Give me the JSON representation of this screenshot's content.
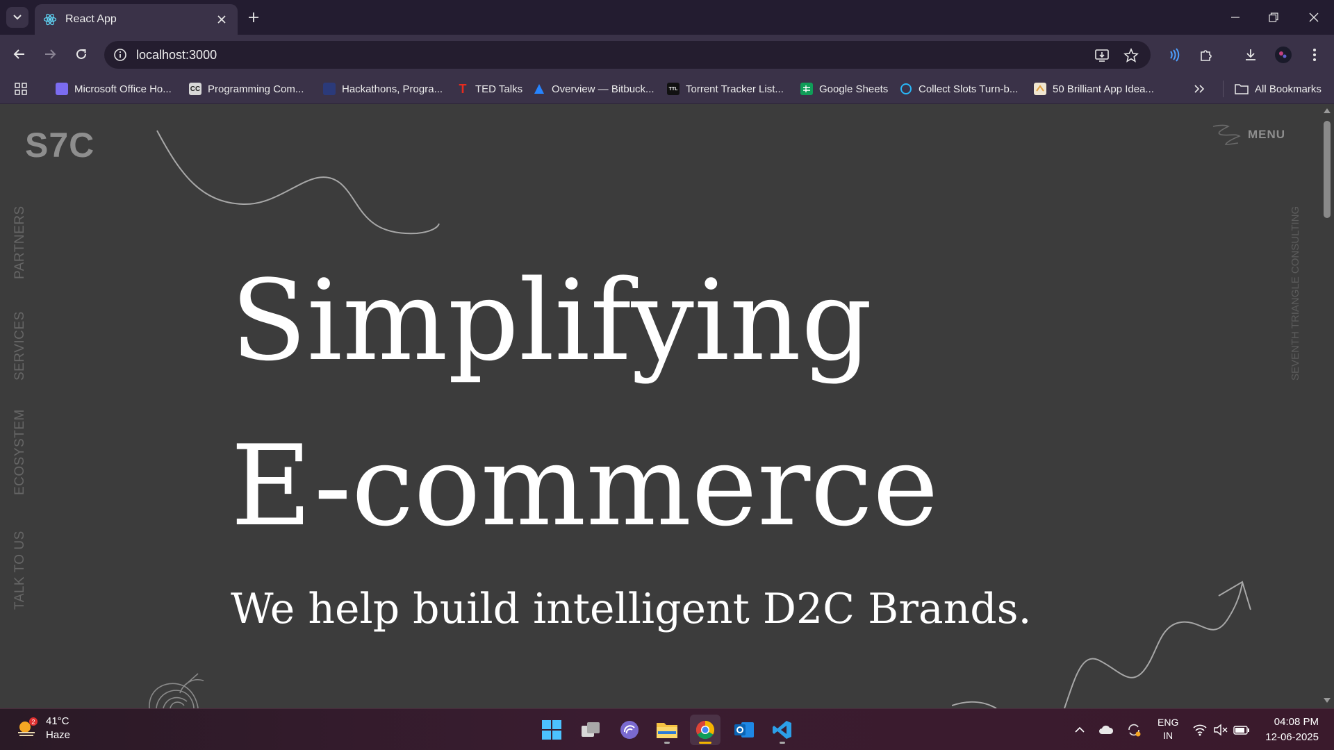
{
  "browser": {
    "tab_title": "React App",
    "url": "localhost:3000",
    "bookmarks": [
      {
        "label": "Microsoft Office Ho...",
        "icon": "office-icon",
        "color": "#7b6cf0"
      },
      {
        "label": "Programming Com...",
        "icon": "cc-icon",
        "color": "#d8d8d8"
      },
      {
        "label": "Hackathons, Progra...",
        "icon": "hackathon-icon",
        "color": "#2b3a7a"
      },
      {
        "label": "TED Talks",
        "icon": "ted-icon",
        "color": "#e62b1e"
      },
      {
        "label": "Overview — Bitbuck...",
        "icon": "bitbucket-icon",
        "color": "#2684ff"
      },
      {
        "label": "Torrent Tracker List...",
        "icon": "torrent-icon",
        "color": "#111111"
      },
      {
        "label": "Google Sheets",
        "icon": "sheets-icon",
        "color": "#0f9d58"
      },
      {
        "label": "Collect Slots Turn-b...",
        "icon": "slots-icon",
        "color": "#29b6f6"
      },
      {
        "label": "50 Brilliant App Idea...",
        "icon": "idea-icon",
        "color": "#e0a040"
      }
    ],
    "all_bookmarks_label": "All Bookmarks"
  },
  "page": {
    "logo": "S7C",
    "menu_label": "MENU",
    "side_nav": [
      "PARTNERS",
      "SERVICES",
      "ECOSYSTEM",
      "TALK TO US"
    ],
    "side_right": "SEVENTH TRIANGLE CONSULTING",
    "hero_line1": "Simplifying",
    "hero_line2": "E-commerce",
    "tagline": "We help build intelligent D2C Brands."
  },
  "taskbar": {
    "weather_temp": "41°C",
    "weather_desc": "Haze",
    "weather_badge": "2",
    "lang_line1": "ENG",
    "lang_line2": "IN",
    "time": "04:08 PM",
    "date": "12-06-2025"
  },
  "colors": {
    "page_bg": "#3c3c3c",
    "hero_text": "#ffffff",
    "browser_chrome": "#3a3248",
    "tab_strip": "#231c30"
  }
}
